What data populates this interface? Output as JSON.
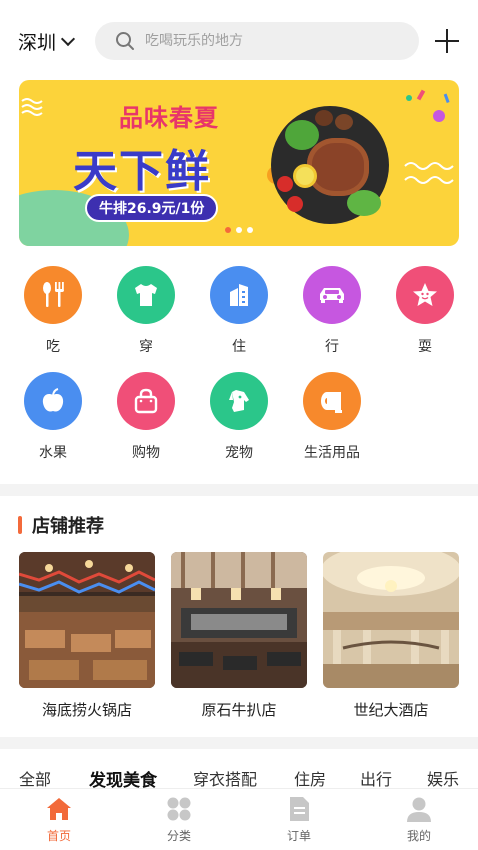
{
  "header": {
    "city": "深圳",
    "search_placeholder": "吃喝玩乐的地方"
  },
  "banner": {
    "subtitle": "品味春夏",
    "title": "天下鲜",
    "promo": "牛排26.9元/1份",
    "slides": 3,
    "active_slide": 1
  },
  "categories": [
    {
      "label": "吃",
      "icon": "fork-spoon-icon",
      "color": "#f7892c"
    },
    {
      "label": "穿",
      "icon": "tshirt-icon",
      "color": "#2bc68a"
    },
    {
      "label": "住",
      "icon": "building-icon",
      "color": "#4a8ef0"
    },
    {
      "label": "行",
      "icon": "car-icon",
      "color": "#c657e0"
    },
    {
      "label": "耍",
      "icon": "star-face-icon",
      "color": "#f04f78"
    },
    {
      "label": "水果",
      "icon": "apple-icon",
      "color": "#4a8ef0"
    },
    {
      "label": "购物",
      "icon": "shopping-bag-icon",
      "color": "#f04f78"
    },
    {
      "label": "宠物",
      "icon": "dog-icon",
      "color": "#2bc68a"
    },
    {
      "label": "生活用品",
      "icon": "tissue-roll-icon",
      "color": "#f7892c"
    }
  ],
  "stores_section": {
    "title": "店铺推荐",
    "stores": [
      {
        "name": "海底捞火锅店"
      },
      {
        "name": "原石牛扒店"
      },
      {
        "name": "世纪大酒店"
      }
    ]
  },
  "filters": [
    {
      "label": "全部",
      "active": false
    },
    {
      "label": "发现美食",
      "active": true
    },
    {
      "label": "穿衣搭配",
      "active": false
    },
    {
      "label": "住房",
      "active": false
    },
    {
      "label": "出行",
      "active": false
    },
    {
      "label": "娱乐",
      "active": false
    }
  ],
  "tabbar": [
    {
      "label": "首页",
      "icon": "home-icon",
      "active": true
    },
    {
      "label": "分类",
      "icon": "grid-icon",
      "active": false
    },
    {
      "label": "订单",
      "icon": "document-icon",
      "active": false
    },
    {
      "label": "我的",
      "icon": "user-icon",
      "active": false
    }
  ],
  "colors": {
    "accent": "#f26a3a",
    "banner_bg": "#fcd33a",
    "divider": "#f3f3f3"
  }
}
